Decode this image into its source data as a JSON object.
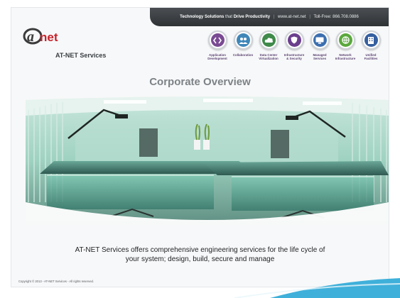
{
  "header": {
    "tagline_prefix": "Technology Solutions",
    "tagline_mid": " that ",
    "tagline_bold": "Drive Productivity",
    "website": "www.at-net.net",
    "phone": "Toll-Free: 866.708.0886",
    "separator": "|"
  },
  "logo": {
    "mark": "net",
    "brand": "AT-NET Services"
  },
  "services": [
    {
      "label_1": "Application",
      "label_2": "Development",
      "icon": "code-icon",
      "color": "#7a4a93"
    },
    {
      "label_1": "Collaboration",
      "label_2": "",
      "icon": "people-icon",
      "color": "#3f86b8"
    },
    {
      "label_1": "Data Center",
      "label_2": "Virtualization",
      "icon": "cloud-icon",
      "color": "#3f8a4a"
    },
    {
      "label_1": "Infrastructure",
      "label_2": "& Security",
      "icon": "shield-icon",
      "color": "#6b3f8d"
    },
    {
      "label_1": "Managed",
      "label_2": "Services",
      "icon": "monitor-icon",
      "color": "#3c6fb0"
    },
    {
      "label_1": "Network",
      "label_2": "Infrastructure",
      "icon": "globe-icon",
      "color": "#5aa83d"
    },
    {
      "label_1": "Unified",
      "label_2": "Facilities",
      "icon": "building-icon",
      "color": "#355f9f"
    }
  ],
  "title": "Corporate Overview",
  "caption_line1": "AT-NET Services offers comprehensive engineering services for the life cycle of",
  "caption_line2": "your system; design, build, secure and manage",
  "copyright": "Copyright © 2013 - AT-NET Services - All rights reserved.",
  "colors": {
    "topbar": "#3a3e42",
    "title": "#7d8286",
    "accent_blue": "#2aa7d6",
    "photo_tint": "#7fc7b2",
    "logo_red": "#c8232c"
  }
}
